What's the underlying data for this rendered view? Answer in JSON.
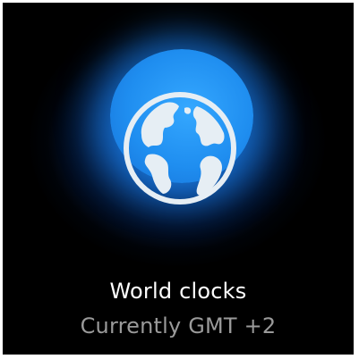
{
  "widget": {
    "title": "World clocks",
    "subtitle": "Currently GMT +2",
    "icon": "globe-icon"
  },
  "colors": {
    "background": "#000000",
    "glow": "#1f8ef0",
    "title_text": "#ffffff",
    "subtitle_text": "#9a9a9a",
    "globe_fill": "#e6eef4"
  }
}
